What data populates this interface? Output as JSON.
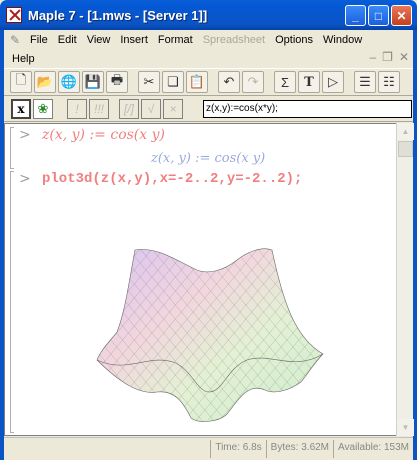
{
  "window": {
    "title": "Maple 7 - [1.mws - [Server 1]]"
  },
  "menu": {
    "items": [
      "File",
      "Edit",
      "View",
      "Insert",
      "Format",
      "Spreadsheet",
      "Options",
      "Window"
    ],
    "help": "Help"
  },
  "toolbar": {
    "buttons": [
      "new",
      "open",
      "open-url",
      "save",
      "print",
      "cut",
      "copy",
      "paste",
      "undo",
      "redo",
      "sum",
      "text",
      "execute",
      "insert-group",
      "remove-group"
    ]
  },
  "context_bar": {
    "x_label": "x",
    "bang": "!",
    "bangs": "!!!",
    "fraction": "[/]",
    "check": "√",
    "cross": "×",
    "command_value": "z(x,y):=cos(x*y);"
  },
  "worksheet": {
    "prompt": ">",
    "input_1": "z(x, y) := cos(x y)",
    "output_1": "z(x, y) := cos(x y)",
    "input_2": "plot3d(z(x,y),x=-2..2,y=-2..2);"
  },
  "status": {
    "time": "Time:  6.8s",
    "bytes": "Bytes: 3.62M",
    "available": "Available: 153M"
  }
}
